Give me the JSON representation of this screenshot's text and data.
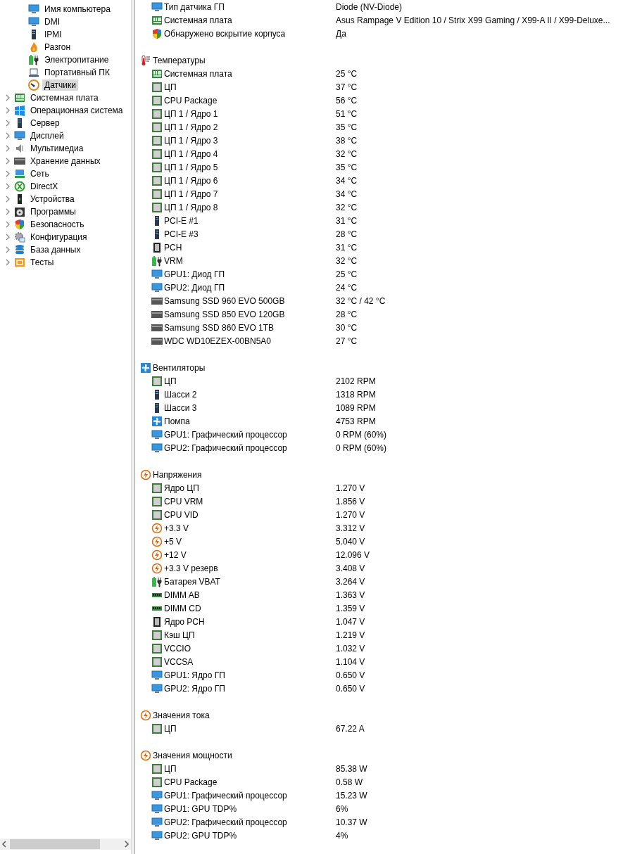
{
  "tree": {
    "sub_items": [
      {
        "label": "Имя компьютера",
        "kind": "monitor",
        "selected": false
      },
      {
        "label": "DMI",
        "kind": "monitor",
        "selected": false
      },
      {
        "label": "IPMI",
        "kind": "server",
        "selected": false
      },
      {
        "label": "Разгон",
        "kind": "flame",
        "selected": false
      },
      {
        "label": "Электропитание",
        "kind": "power",
        "selected": false
      },
      {
        "label": "Портативный ПК",
        "kind": "laptop",
        "selected": false
      },
      {
        "label": "Датчики",
        "kind": "gauge",
        "selected": true
      }
    ],
    "items": [
      {
        "label": "Системная плата",
        "kind": "board",
        "expanded": false,
        "selected": false
      },
      {
        "label": "Операционная система",
        "kind": "windows",
        "expanded": false,
        "selected": false
      },
      {
        "label": "Сервер",
        "kind": "server",
        "expanded": false,
        "selected": false
      },
      {
        "label": "Дисплей",
        "kind": "monitor",
        "expanded": false,
        "selected": false
      },
      {
        "label": "Мультимедиа",
        "kind": "speaker",
        "expanded": false,
        "selected": false
      },
      {
        "label": "Хранение данных",
        "kind": "drive",
        "expanded": false,
        "selected": false
      },
      {
        "label": "Сеть",
        "kind": "network",
        "expanded": false,
        "selected": false
      },
      {
        "label": "DirectX",
        "kind": "xbox",
        "expanded": false,
        "selected": false
      },
      {
        "label": "Устройства",
        "kind": "device",
        "expanded": false,
        "selected": false
      },
      {
        "label": "Программы",
        "kind": "disc",
        "expanded": false,
        "selected": false
      },
      {
        "label": "Безопасность",
        "kind": "shield",
        "expanded": false,
        "selected": false
      },
      {
        "label": "Конфигурация",
        "kind": "gear",
        "expanded": false,
        "selected": false
      },
      {
        "label": "База данных",
        "kind": "database",
        "expanded": false,
        "selected": false
      },
      {
        "label": "Тесты",
        "kind": "tests",
        "expanded": false,
        "selected": false
      }
    ]
  },
  "sections": [
    {
      "rows": [
        {
          "label": "Тип датчика ГП",
          "kind": "monitor",
          "value": "Diode  (NV-Diode)"
        },
        {
          "label": "Системная плата",
          "kind": "board",
          "value": "Asus Rampage V Edition 10 / Strix X99 Gaming / X99-A II / X99-Deluxe..."
        },
        {
          "label": "Обнаружено вскрытие корпуса",
          "kind": "shield",
          "value": "Да"
        }
      ]
    },
    {
      "title": "Температуры",
      "kind": "thermo",
      "rows": [
        {
          "label": "Системная плата",
          "kind": "board",
          "value": "25 °C"
        },
        {
          "label": "ЦП",
          "kind": "chip",
          "value": "37 °C"
        },
        {
          "label": "CPU Package",
          "kind": "chip",
          "value": "56 °C"
        },
        {
          "label": "ЦП 1 / Ядро 1",
          "kind": "chip",
          "value": "51 °C"
        },
        {
          "label": "ЦП 1 / Ядро 2",
          "kind": "chip",
          "value": "35 °C"
        },
        {
          "label": "ЦП 1 / Ядро 3",
          "kind": "chip",
          "value": "38 °C"
        },
        {
          "label": "ЦП 1 / Ядро 4",
          "kind": "chip",
          "value": "32 °C"
        },
        {
          "label": "ЦП 1 / Ядро 5",
          "kind": "chip",
          "value": "35 °C"
        },
        {
          "label": "ЦП 1 / Ядро 6",
          "kind": "chip",
          "value": "34 °C"
        },
        {
          "label": "ЦП 1 / Ядро 7",
          "kind": "chip",
          "value": "34 °C"
        },
        {
          "label": "ЦП 1 / Ядро 8",
          "kind": "chip",
          "value": "32 °C"
        },
        {
          "label": "PCI-E #1",
          "kind": "server",
          "value": "31 °C"
        },
        {
          "label": "PCI-E #3",
          "kind": "server",
          "value": "28 °C"
        },
        {
          "label": "PCH",
          "kind": "southbridge",
          "value": "31 °C"
        },
        {
          "label": "VRM",
          "kind": "power",
          "value": "32 °C"
        },
        {
          "label": "GPU1: Диод ГП",
          "kind": "monitor",
          "value": "25 °C"
        },
        {
          "label": "GPU2: Диод ГП",
          "kind": "monitor",
          "value": "24 °C"
        },
        {
          "label": "Samsung SSD 960 EVO 500GB",
          "kind": "drive",
          "value": "32 °C / 42 °C"
        },
        {
          "label": "Samsung SSD 850 EVO 120GB",
          "kind": "drive",
          "value": "28 °C"
        },
        {
          "label": "Samsung SSD 860 EVO 1TB",
          "kind": "drive",
          "value": "30 °C"
        },
        {
          "label": "WDC WD10EZEX-00BN5A0",
          "kind": "drive",
          "value": "27 °C"
        }
      ]
    },
    {
      "title": "Вентиляторы",
      "kind": "fan",
      "rows": [
        {
          "label": "ЦП",
          "kind": "chip",
          "value": "2102 RPM"
        },
        {
          "label": "Шасси 2",
          "kind": "server",
          "value": "1318 RPM"
        },
        {
          "label": "Шасси 3",
          "kind": "server",
          "value": "1089 RPM"
        },
        {
          "label": "Помпа",
          "kind": "fan",
          "value": "4753 RPM"
        },
        {
          "label": "GPU1: Графический процессор",
          "kind": "monitor",
          "value": "0 RPM  (60%)"
        },
        {
          "label": "GPU2: Графический процессор",
          "kind": "monitor",
          "value": "0 RPM  (60%)"
        }
      ]
    },
    {
      "title": "Напряжения",
      "kind": "bolt",
      "rows": [
        {
          "label": "Ядро ЦП",
          "kind": "chip",
          "value": "1.270 V"
        },
        {
          "label": "CPU VRM",
          "kind": "chip",
          "value": "1.856 V"
        },
        {
          "label": "CPU VID",
          "kind": "chip",
          "value": "1.270 V"
        },
        {
          "label": "+3.3 V",
          "kind": "bolt",
          "value": "3.312 V"
        },
        {
          "label": "+5 V",
          "kind": "bolt",
          "value": "5.040 V"
        },
        {
          "label": "+12 V",
          "kind": "bolt",
          "value": "12.096 V"
        },
        {
          "label": "+3.3 V резерв",
          "kind": "bolt",
          "value": "3.408 V"
        },
        {
          "label": "Батарея VBAT",
          "kind": "power",
          "value": "3.264 V"
        },
        {
          "label": "DIMM AB",
          "kind": "memory",
          "value": "1.363 V"
        },
        {
          "label": "DIMM CD",
          "kind": "memory",
          "value": "1.359 V"
        },
        {
          "label": "Ядро PCH",
          "kind": "southbridge",
          "value": "1.047 V"
        },
        {
          "label": "Кэш ЦП",
          "kind": "chip",
          "value": "1.219 V"
        },
        {
          "label": "VCCIO",
          "kind": "chip",
          "value": "1.032 V"
        },
        {
          "label": "VCCSA",
          "kind": "chip",
          "value": "1.104 V"
        },
        {
          "label": "GPU1: Ядро ГП",
          "kind": "monitor",
          "value": "0.650 V"
        },
        {
          "label": "GPU2: Ядро ГП",
          "kind": "monitor",
          "value": "0.650 V"
        }
      ]
    },
    {
      "title": "Значения тока",
      "kind": "bolt",
      "rows": [
        {
          "label": "ЦП",
          "kind": "chip",
          "value": "67.22 A"
        }
      ]
    },
    {
      "title": "Значения мощности",
      "kind": "bolt",
      "rows": [
        {
          "label": "ЦП",
          "kind": "chip",
          "value": "85.38 W"
        },
        {
          "label": "CPU Package",
          "kind": "chip",
          "value": "0.58 W"
        },
        {
          "label": "GPU1: Графический процессор",
          "kind": "monitor",
          "value": "15.23 W"
        },
        {
          "label": "GPU1: GPU TDP%",
          "kind": "monitor",
          "value": "6%"
        },
        {
          "label": "GPU2: Графический процессор",
          "kind": "monitor",
          "value": "10.37 W"
        },
        {
          "label": "GPU2: GPU TDP%",
          "kind": "monitor",
          "value": "4%"
        }
      ]
    }
  ]
}
